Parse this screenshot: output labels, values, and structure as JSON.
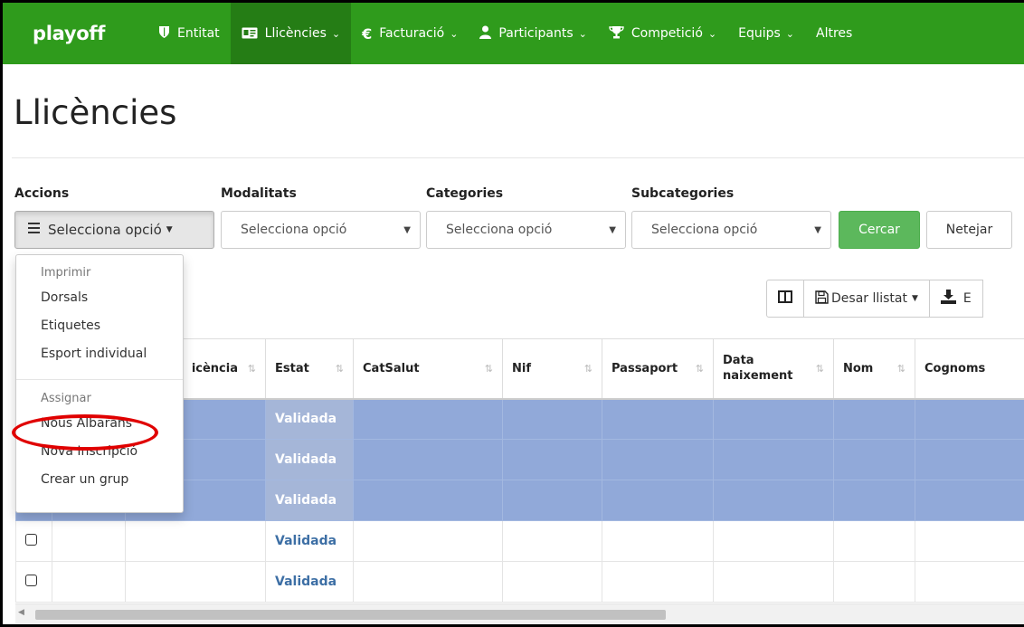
{
  "navbar": {
    "brand": "playoff",
    "items": [
      {
        "label": "Entitat",
        "icon": "shield-icon"
      },
      {
        "label": "Llicències",
        "icon": "id-card-icon"
      },
      {
        "label": "Facturació",
        "icon": "euro-icon"
      },
      {
        "label": "Participants",
        "icon": "user-icon"
      },
      {
        "label": "Competició",
        "icon": "trophy-icon"
      },
      {
        "label": "Equips"
      },
      {
        "label": "Altres"
      }
    ]
  },
  "page": {
    "title": "Llicències"
  },
  "filters": {
    "accions": {
      "label": "Accions",
      "value": "Selecciona opció"
    },
    "modalitats": {
      "label": "Modalitats",
      "value": "Selecciona opció"
    },
    "categories": {
      "label": "Categories",
      "value": "Selecciona opció"
    },
    "subcategories": {
      "label": "Subcategories",
      "value": "Selecciona opció"
    },
    "search_label": "Cercar",
    "clear_label": "Netejar"
  },
  "toolbar": {
    "save_list_label": "Desar llistat",
    "export_label": "E"
  },
  "dropdown": {
    "group1_header": "Imprimir",
    "group1_items": [
      "Dorsals",
      "Etiquetes",
      "Esport individual"
    ],
    "group2_header": "Assignar",
    "group2_items": [
      "Nous Albarans",
      "Nova Inscripció",
      "Crear un grup"
    ]
  },
  "table": {
    "headers": [
      "icència",
      "Estat",
      "CatSalut",
      "Nif",
      "Passaport",
      "Data naixement",
      "Nom",
      "Cognoms"
    ],
    "rows": [
      {
        "estat": "Validada",
        "selected": true
      },
      {
        "estat": "Validada",
        "selected": true
      },
      {
        "estat": "Validada",
        "selected": true
      },
      {
        "estat": "Validada",
        "selected": false
      },
      {
        "estat": "Validada",
        "selected": false
      }
    ]
  },
  "colors": {
    "navbar": "#2f9b1c",
    "selected_row": "#91a9d9",
    "success": "#5cb85c",
    "highlight": "#e00000"
  }
}
